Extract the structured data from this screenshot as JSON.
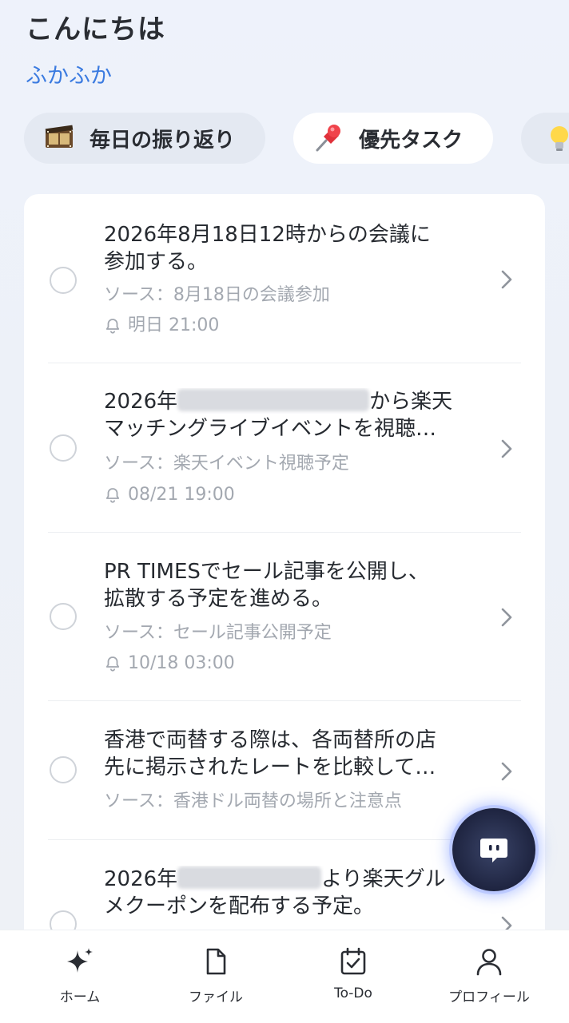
{
  "header": {
    "greeting": "こんにちは",
    "username": "ふかふか"
  },
  "chips": [
    {
      "label": "毎日の振り返り",
      "icon": "film-icon"
    },
    {
      "label": "優先タスク",
      "icon": "pushpin-icon"
    },
    {
      "label": "",
      "icon": "lightbulb-icon"
    }
  ],
  "tasks": [
    {
      "title_lines": [
        "2026年8月18日12時からの会議に",
        "参加する。"
      ],
      "source": "ソース：8月18日の会議参加",
      "reminder": "明日 21:00"
    },
    {
      "title_lines": [
        "2026年",
        "から楽天",
        "マッチングライブイベントを視聴…"
      ],
      "source": "ソース：楽天イベント視聴予定",
      "reminder": "08/21 19:00"
    },
    {
      "title_lines": [
        "PR TIMESでセール記事を公開し、",
        "拡散する予定を進める。"
      ],
      "source": "ソース：セール記事公開予定",
      "reminder": "10/18 03:00"
    },
    {
      "title_lines": [
        "香港で両替する際は、各両替所の店",
        "先に掲示されたレートを比較して…"
      ],
      "source": "ソース：香港ドル両替の場所と注意点"
    },
    {
      "title_lines": [
        "2026年",
        "より楽天グル",
        "メクーポンを配布する予定。"
      ]
    }
  ],
  "tabbar": [
    {
      "label": "ホーム",
      "icon": "sparkle-icon"
    },
    {
      "label": "ファイル",
      "icon": "file-icon"
    },
    {
      "label": "To-Do",
      "icon": "calendar-check-icon"
    },
    {
      "label": "プロフィール",
      "icon": "user-icon"
    }
  ],
  "colors": {
    "accent": "#3b7be0",
    "fab": "#1e2440"
  }
}
